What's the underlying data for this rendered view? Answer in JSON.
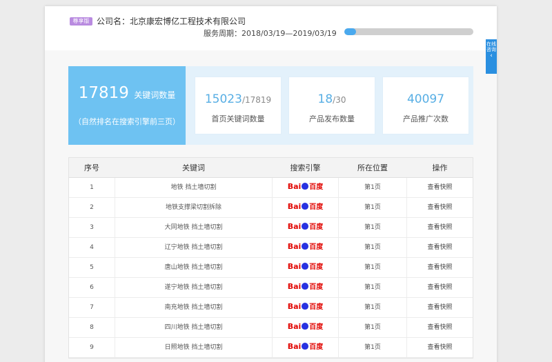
{
  "header": {
    "badge": "尊享版",
    "company": "公司名：北京康宏博亿工程技术有限公司",
    "service_period": "服务周期：2018/03/19—2019/03/19",
    "progress_fraction": 0.09
  },
  "side_tab": {
    "label": "在线咨询",
    "arrow": "‹"
  },
  "stats": {
    "main_value": "17819",
    "main_label": "关键词数量",
    "main_sub": "（自然排名在搜索引擎前三页）",
    "cards": [
      {
        "value": "15023",
        "denominator": "/17819",
        "label": "首页关键词数量"
      },
      {
        "value": "18",
        "denominator": "/30",
        "label": "产品发布数量"
      },
      {
        "value": "40097",
        "denominator": "",
        "label": "产品推广次数"
      }
    ]
  },
  "table": {
    "headers": [
      "序号",
      "关键词",
      "搜索引擎",
      "所在位置",
      "操作"
    ],
    "engine": {
      "bai": "Bai",
      "du": "百度"
    },
    "rows": [
      {
        "no": "1",
        "keyword": "地铁 挡土墙切割",
        "position": "第1页",
        "action": "查看快照"
      },
      {
        "no": "2",
        "keyword": "地铁支撑梁切割拆除",
        "position": "第1页",
        "action": "查看快照"
      },
      {
        "no": "3",
        "keyword": "大同地铁 挡土墙切割",
        "position": "第1页",
        "action": "查看快照"
      },
      {
        "no": "4",
        "keyword": "辽宁地铁 挡土墙切割",
        "position": "第1页",
        "action": "查看快照"
      },
      {
        "no": "5",
        "keyword": "唐山地铁 挡土墙切割",
        "position": "第1页",
        "action": "查看快照"
      },
      {
        "no": "6",
        "keyword": "遂宁地铁 挡土墙切割",
        "position": "第1页",
        "action": "查看快照"
      },
      {
        "no": "7",
        "keyword": "南充地铁 挡土墙切割",
        "position": "第1页",
        "action": "查看快照"
      },
      {
        "no": "8",
        "keyword": "四川地铁 挡土墙切割",
        "position": "第1页",
        "action": "查看快照"
      },
      {
        "no": "9",
        "keyword": "日照地铁 挡土墙切割",
        "position": "第1页",
        "action": "查看快照"
      }
    ]
  }
}
